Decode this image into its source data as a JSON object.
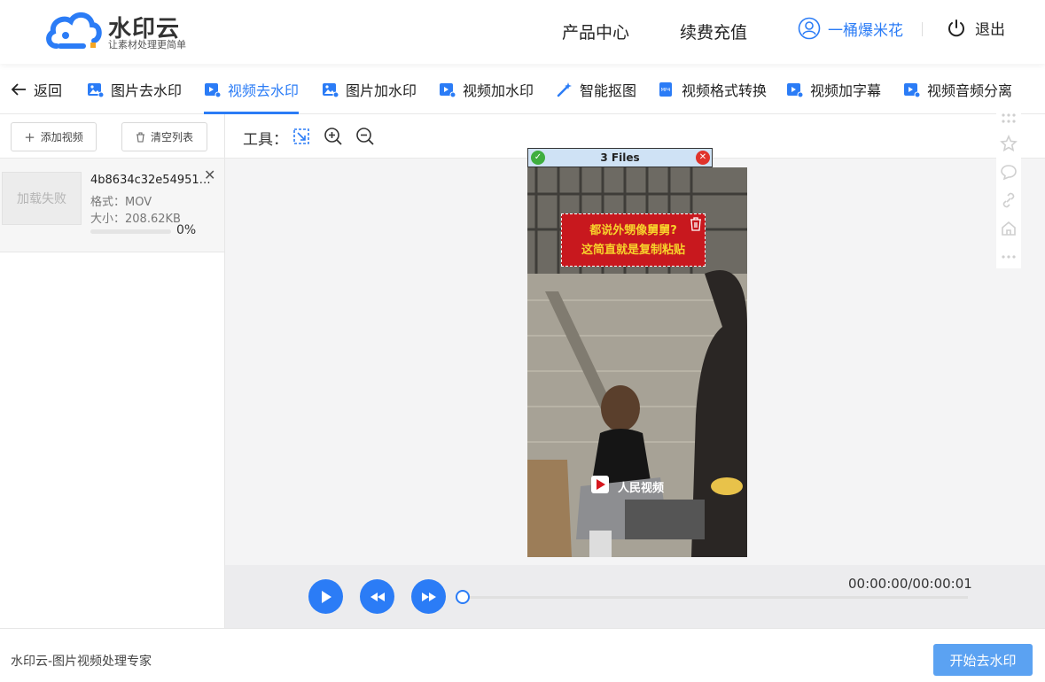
{
  "header": {
    "logo_name": "水印云",
    "logo_slogan": "让素材处理更简单",
    "nav": [
      "产品中心",
      "续费充值"
    ],
    "user_name": "一桶爆米花",
    "logout": "退出"
  },
  "tabs": [
    {
      "label": "返回",
      "icon": "arrow-left-icon"
    },
    {
      "label": "图片去水印",
      "icon": "image-icon"
    },
    {
      "label": "视频去水印",
      "icon": "video-icon",
      "active": true
    },
    {
      "label": "图片加水印",
      "icon": "image-icon"
    },
    {
      "label": "视频加水印",
      "icon": "video-icon"
    },
    {
      "label": "智能抠图",
      "icon": "magic-wand-icon"
    },
    {
      "label": "视频格式转换",
      "icon": "mp4-icon"
    },
    {
      "label": "视频加字幕",
      "icon": "video-icon"
    },
    {
      "label": "视频音频分离",
      "icon": "video-icon"
    }
  ],
  "sidebar": {
    "add_video": "添加视频",
    "clear_list": "清空列表",
    "file": {
      "thumb_text": "加载失败",
      "name": "4b8634c32e5495127…",
      "format": "格式：MOV",
      "size": "大小：208.62KB",
      "progress_percent": 0,
      "progress_label": "0%"
    }
  },
  "toolbar": {
    "label": "工具："
  },
  "player": {
    "overlay_title": "3 Files",
    "caption_line1": "都说外甥像舅舅?",
    "caption_line2": "这简直就是复制粘贴",
    "watermark": "人民视频",
    "time": "00:00:00/00:00:01",
    "progress": 0
  },
  "footer": {
    "title": "水印云-图片视频处理专家",
    "start_button": "开始去水印"
  },
  "colors": {
    "accent": "#2b7cf6",
    "button": "#5ba2f2"
  }
}
